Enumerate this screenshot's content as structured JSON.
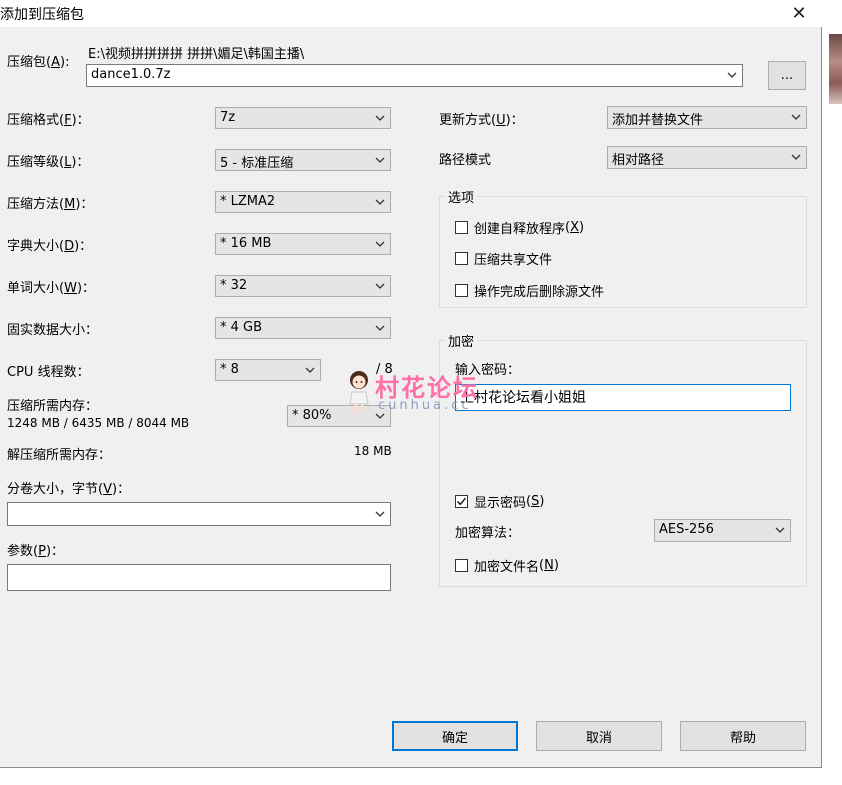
{
  "window": {
    "title": "添加到压缩包",
    "close_glyph": "✕"
  },
  "archive": {
    "label": "压缩包",
    "hotkey": "A",
    "path": "E:\\视频拼拼拼拼 拼拼\\媚足\\韩国主播\\",
    "filename": "dance1.0.7z",
    "browse_label": "..."
  },
  "left": {
    "format": {
      "label": "压缩格式",
      "hotkey": "F",
      "value": "7z"
    },
    "level": {
      "label": "压缩等级",
      "hotkey": "L",
      "value": "5 - 标准压缩"
    },
    "method": {
      "label": "压缩方法",
      "hotkey": "M",
      "value": "* LZMA2"
    },
    "dict": {
      "label": "字典大小",
      "hotkey": "D",
      "value": "* 16 MB"
    },
    "word": {
      "label": "单词大小",
      "hotkey": "W",
      "value": "* 32"
    },
    "solid": {
      "label": "固实数据大小：",
      "value": "* 4 GB"
    },
    "cpu": {
      "label": "CPU 线程数：",
      "value": "* 8",
      "max": "/ 8"
    },
    "mem_compress": {
      "label": "压缩所需内存：",
      "detail": "1248 MB / 6435 MB / 8044 MB",
      "percent": "* 80%"
    },
    "mem_decompress": {
      "label": "解压缩所需内存：",
      "value": "18 MB"
    },
    "volume": {
      "label": "分卷大小，字节",
      "hotkey": "V",
      "value": ""
    },
    "params": {
      "label": "参数",
      "hotkey": "P",
      "value": ""
    }
  },
  "right": {
    "update": {
      "label": "更新方式",
      "hotkey": "U",
      "value": "添加并替换文件"
    },
    "pathmode": {
      "label": "路径模式",
      "value": "相对路径"
    },
    "options": {
      "title": "选项",
      "sfx": {
        "label": "创建自释放程序",
        "hotkey": "X",
        "checked": false
      },
      "shared": {
        "label": "压缩共享文件",
        "checked": false
      },
      "delete": {
        "label": "操作完成后删除源文件",
        "checked": false
      }
    },
    "encryption": {
      "title": "加密",
      "password_label": "输入密码：",
      "password_value": "上村花论坛看小姐姐",
      "show_password": {
        "label": "显示密码",
        "hotkey": "S",
        "checked": true
      },
      "method_label": "加密算法：",
      "method_value": "AES-256",
      "encrypt_names": {
        "label": "加密文件名",
        "hotkey": "N",
        "checked": false
      }
    }
  },
  "buttons": {
    "ok": "确定",
    "cancel": "取消",
    "help": "帮助"
  },
  "watermark": {
    "text": "村花论坛",
    "sub": "cunhua.cc"
  },
  "colors": {
    "accent": "#0078d7",
    "dialog_bg": "#f0f0f0",
    "watermark": "#ff6fa8"
  }
}
